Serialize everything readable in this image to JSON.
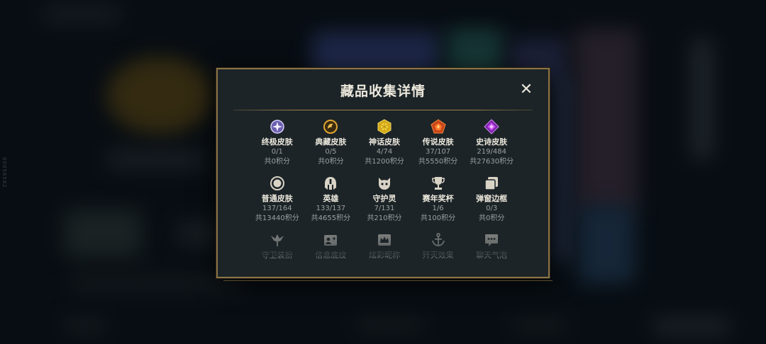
{
  "modal": {
    "title": "藏品收集详情",
    "close_glyph": "✕"
  },
  "side_code": "00056582",
  "items": [
    {
      "name": "终极皮肤",
      "count": "0/1",
      "points": "共0积分",
      "icon": "ultimate-skin-icon",
      "color": "#c9b7f0"
    },
    {
      "name": "典藏皮肤",
      "count": "0/5",
      "points": "共0积分",
      "icon": "prestige-skin-icon",
      "color": "#e0a52e"
    },
    {
      "name": "神话皮肤",
      "count": "4/74",
      "points": "共1200积分",
      "icon": "mythic-skin-icon",
      "color": "#e8c32a"
    },
    {
      "name": "传说皮肤",
      "count": "37/107",
      "points": "共5550积分",
      "icon": "legendary-skin-icon",
      "color": "#e8651e"
    },
    {
      "name": "史诗皮肤",
      "count": "219/484",
      "points": "共27630积分",
      "icon": "epic-skin-icon",
      "color": "#b23ae0"
    },
    {
      "name": "普通皮肤",
      "count": "137/164",
      "points": "共13440积分",
      "icon": "common-skin-icon",
      "color": "#d9d3c6"
    },
    {
      "name": "英雄",
      "count": "133/137",
      "points": "共4655积分",
      "icon": "hero-helmet-icon",
      "color": "#d9d3c6"
    },
    {
      "name": "守护灵",
      "count": "7/131",
      "points": "共210积分",
      "icon": "guardian-spirit-icon",
      "color": "#d9d3c6"
    },
    {
      "name": "赛年奖杯",
      "count": "1/6",
      "points": "共100积分",
      "icon": "trophy-icon",
      "color": "#d9d3c6"
    },
    {
      "name": "弹窗边框",
      "count": "0/3",
      "points": "共0积分",
      "icon": "popup-frame-icon",
      "color": "#d9d3c6"
    },
    {
      "name": "守卫装扮",
      "icon": "ward-skin-icon",
      "color": "#8c8e8a"
    },
    {
      "name": "信息底纹",
      "icon": "info-card-icon",
      "color": "#8c8e8a"
    },
    {
      "name": "炫彩昵称",
      "icon": "nickname-crown-icon",
      "color": "#8c8e8a"
    },
    {
      "name": "歼灭效果",
      "icon": "anchor-icon",
      "color": "#8c8e8a"
    },
    {
      "name": "聊天气泡",
      "icon": "chat-bubble-icon",
      "color": "#8c8e8a"
    }
  ]
}
